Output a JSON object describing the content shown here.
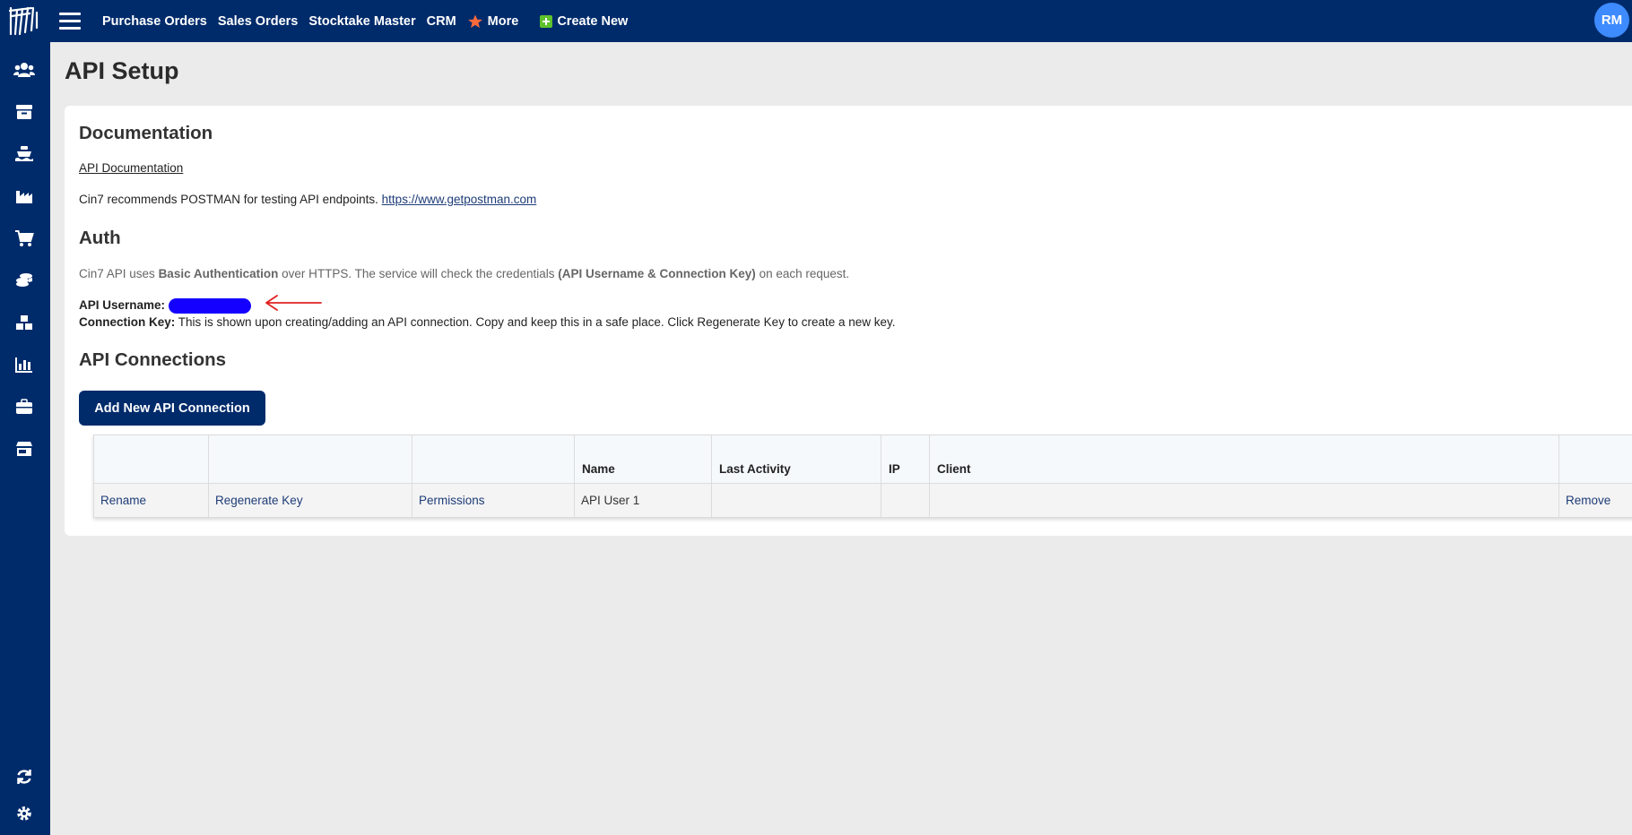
{
  "topnav": {
    "items": [
      "Purchase Orders",
      "Sales Orders",
      "Stocktake Master",
      "CRM"
    ],
    "more_label": "More",
    "create_label": "Create New"
  },
  "user": {
    "initials": "RM"
  },
  "sidebar": {
    "icons": [
      "users-icon",
      "inventory-icon",
      "shipping-icon",
      "factory-icon",
      "cart-icon",
      "coins-icon",
      "warehouse-icon",
      "reports-icon",
      "briefcase-icon",
      "store-icon",
      "sync-icon",
      "gear-icon"
    ]
  },
  "page": {
    "title": "API Setup"
  },
  "documentation": {
    "title": "Documentation",
    "link_label": "API Documentation",
    "recommend_text": "Cin7 recommends POSTMAN for testing API endpoints.",
    "postman_link": "https://www.getpostman.com"
  },
  "auth": {
    "title": "Auth",
    "desc_1": "Cin7 API uses",
    "desc_bold_1": "Basic Authentication",
    "desc_2": "over HTTPS. The service will check the credentials",
    "desc_bold_2": "(API Username & Connection Key)",
    "desc_3": "on each request.",
    "username_label": "API Username:",
    "key_label": "Connection Key:",
    "key_text": "This is shown upon creating/adding an API connection. Copy and keep this in a safe place. Click Regenerate Key to create a new key."
  },
  "connections": {
    "title": "API Connections",
    "add_button": "Add New API Connection",
    "headers": [
      "",
      "",
      "",
      "Name",
      "Last Activity",
      "IP",
      "Client",
      ""
    ],
    "rows": [
      {
        "rename": "Rename",
        "regenerate": "Regenerate Key",
        "permissions": "Permissions",
        "name": "API User 1",
        "last_activity": "",
        "ip": "",
        "client": "",
        "remove": "Remove"
      }
    ]
  },
  "colors": {
    "navbar": "#002b6b",
    "avatar": "#3d8bff",
    "link": "#1e3c78",
    "more_star": "#ff6a3d",
    "create_plus": "#5ec22b",
    "annotation_arrow": "#e02020",
    "redaction": "#1400ff"
  }
}
